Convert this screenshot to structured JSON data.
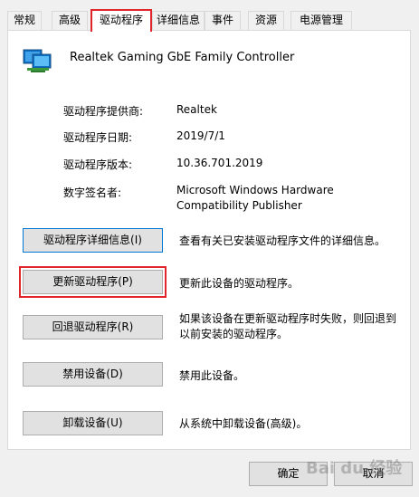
{
  "tabs": [
    {
      "label": "常规",
      "active": false
    },
    {
      "label": "高级",
      "active": false
    },
    {
      "label": "驱动程序",
      "active": true
    },
    {
      "label": "详细信息",
      "active": false
    },
    {
      "label": "事件",
      "active": false
    },
    {
      "label": "资源",
      "active": false
    },
    {
      "label": "电源管理",
      "active": false
    }
  ],
  "device": {
    "name": "Realtek Gaming GbE Family Controller",
    "icon": "network-adapter-icon"
  },
  "properties": {
    "provider_label": "驱动程序提供商:",
    "provider_value": "Realtek",
    "date_label": "驱动程序日期:",
    "date_value": "2019/7/1",
    "version_label": "驱动程序版本:",
    "version_value": "10.36.701.2019",
    "signer_label": "数字签名者:",
    "signer_value_line1": "Microsoft Windows Hardware",
    "signer_value_line2": "Compatibility Publisher"
  },
  "actions": {
    "details_button": "驱动程序详细信息(I)",
    "details_desc": "查看有关已安装驱动程序文件的详细信息。",
    "update_button": "更新驱动程序(P)",
    "update_desc": "更新此设备的驱动程序。",
    "rollback_button": "回退驱动程序(R)",
    "rollback_desc_line1": "如果该设备在更新驱动程序时失败，则回退到",
    "rollback_desc_line2": "以前安装的驱动程序。",
    "disable_button": "禁用设备(D)",
    "disable_desc": "禁用此设备。",
    "uninstall_button": "卸载设备(U)",
    "uninstall_desc": "从系统中卸载设备(高级)。"
  },
  "footer": {
    "ok_label": "确定",
    "cancel_label": "取消"
  },
  "watermark": "Bai du 经验",
  "colors": {
    "highlight_red": "#e0262b",
    "focus_blue": "#0078d7"
  }
}
